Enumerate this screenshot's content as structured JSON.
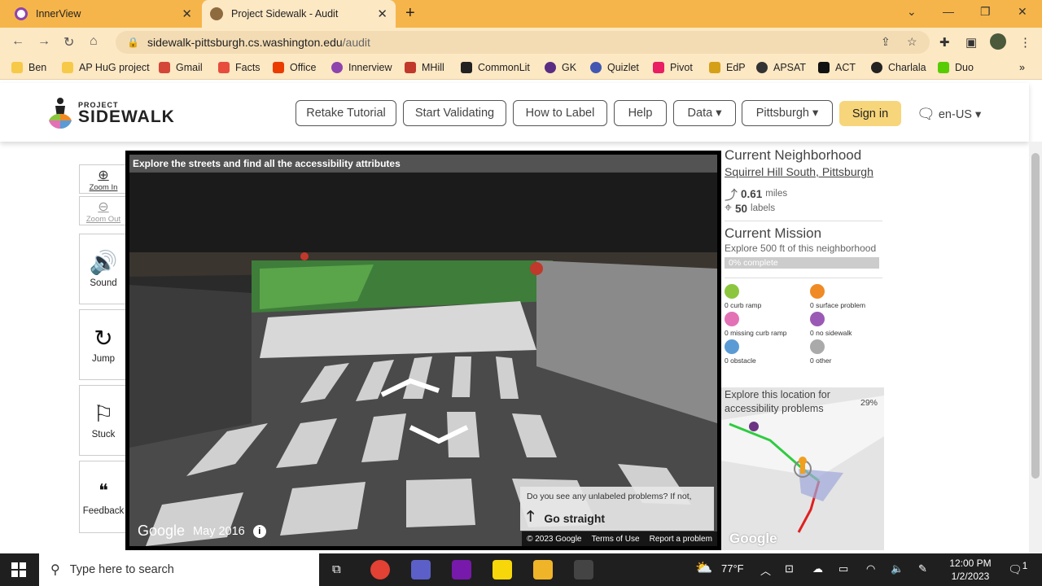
{
  "browser": {
    "tabs": [
      {
        "title": "InnerView",
        "close": "✕"
      },
      {
        "title": "Project Sidewalk - Audit",
        "close": "✕"
      }
    ],
    "new_tab": "+",
    "url_domain": "sidewalk-pittsburgh.cs.washington.edu",
    "url_path": "/audit",
    "bookmarks": [
      "Ben",
      "AP HuG project",
      "Gmail",
      "Facts",
      "Office",
      "Innerview",
      "MHill",
      "CommonLit",
      "GK",
      "Quizlet",
      "Pivot",
      "EdP",
      "APSAT",
      "ACT",
      "Charlala",
      "Duo"
    ],
    "bookmarks_more": "»"
  },
  "header": {
    "logo_small": "PROJECT",
    "logo_big": "SIDEWALK",
    "nav": [
      "Retake Tutorial",
      "Start Validating",
      "How to Label",
      "Help",
      "Data ▾",
      "Pittsburgh ▾"
    ],
    "signin": "Sign in",
    "lang": "en-US ▾"
  },
  "toolbar": {
    "zoom_in": "Zoom In",
    "zoom_out": "Zoom Out",
    "sound": "Sound",
    "jump": "Jump",
    "stuck": "Stuck",
    "feedback": "Feedback"
  },
  "pano": {
    "banner": "Explore the streets and find all the accessibility attributes",
    "google": "Google",
    "date": "May 2016",
    "info": "i",
    "question": "Do you see any unlabeled problems? If not,",
    "go_straight": "Go straight",
    "copyright": "© 2023 Google",
    "terms": "Terms of Use",
    "report": "Report a problem"
  },
  "panel": {
    "current_neighborhood": "Current Neighborhood",
    "neighborhood": "Squirrel Hill South, Pittsburgh",
    "miles_value": "0.61",
    "miles_unit": "miles",
    "labels_value": "50",
    "labels_unit": "labels",
    "current_mission": "Current Mission",
    "mission_text": "Explore 500 ft of this neighborhood",
    "progress": "0% complete",
    "progress_fraction": 0,
    "labels": [
      {
        "text": "0 curb ramp",
        "color": "#8cc63f"
      },
      {
        "text": "0 surface problem",
        "color": "#f08a24"
      },
      {
        "text": "0 missing curb ramp",
        "color": "#e272b5"
      },
      {
        "text": "0 no sidewalk",
        "color": "#9b59b6"
      },
      {
        "text": "0 obstacle",
        "color": "#5b9bd5"
      },
      {
        "text": "0 other",
        "color": "#aaaaaa"
      }
    ],
    "map_message": "Explore this location for accessibility problems",
    "map_pct": "29%",
    "map_google": "Google"
  },
  "taskbar": {
    "search_placeholder": "Type here to search",
    "temp": "77°F",
    "time": "12:00 PM",
    "date": "1/2/2023",
    "notif": "1"
  }
}
